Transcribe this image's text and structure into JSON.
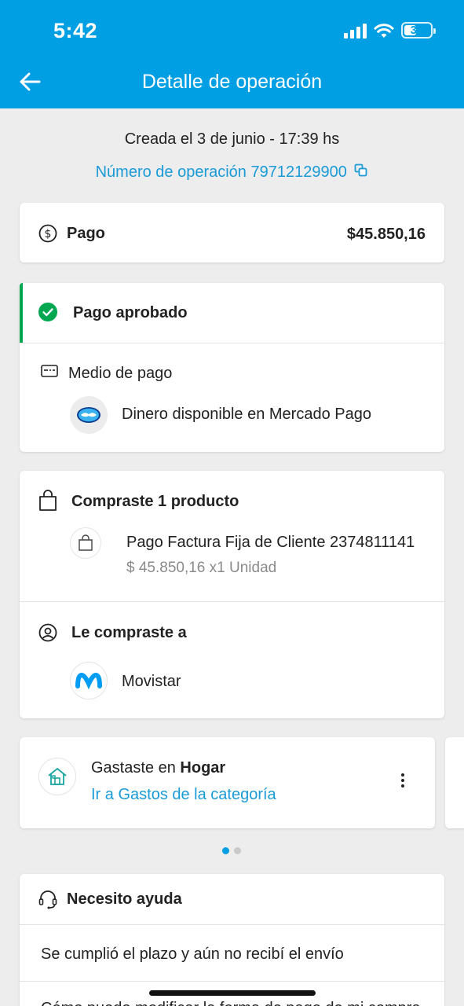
{
  "status_bar": {
    "time": "5:42",
    "battery": "39"
  },
  "header": {
    "title": "Detalle de operación"
  },
  "operation": {
    "created": "Creada el 3 de junio - 17:39 hs",
    "number": "Número de operación 79712129900"
  },
  "payment": {
    "label": "Pago",
    "amount": "$45.850,16"
  },
  "status": {
    "label": "Pago aprobado",
    "method_title": "Medio de pago",
    "method_value": "Dinero disponible en Mercado Pago"
  },
  "purchase": {
    "title": "Compraste 1 producto",
    "product_name": "Pago Factura Fija de Cliente 2374811141",
    "product_detail": "$ 45.850,16 x1 Unidad",
    "seller_title": "Le compraste a",
    "seller_name": "Movistar"
  },
  "category": {
    "prefix": "Gastaste en ",
    "name": "Hogar",
    "link": "Ir a Gastos de la categoría"
  },
  "help": {
    "title": "Necesito ayuda",
    "item1": "Se cumplió el plazo y aún no recibí el envío",
    "item2": "Cómo puedo modificar la forma de pago de mi compra"
  },
  "colors": {
    "brand": "#009ee3",
    "link": "#1a9bd7",
    "success": "#00a650"
  }
}
